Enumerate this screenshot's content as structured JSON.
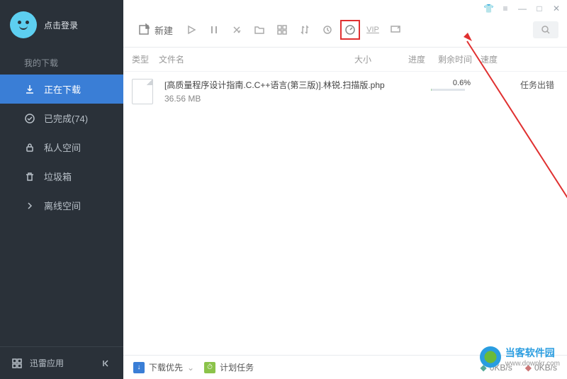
{
  "user": {
    "login_prompt": "点击登录"
  },
  "sidebar": {
    "section": "我的下载",
    "items": [
      {
        "label": "正在下载",
        "icon": "↓"
      },
      {
        "label": "已完成(74)",
        "icon": "✓"
      },
      {
        "label": "私人空间",
        "icon": "🔒"
      },
      {
        "label": "垃圾箱",
        "icon": "🗑"
      },
      {
        "label": "离线空间",
        "icon": "☁"
      }
    ],
    "bottom": {
      "app_label": "迅雷应用",
      "icon": "⊞"
    }
  },
  "toolbar": {
    "new_label": "新建",
    "icons": [
      "play",
      "pause",
      "delete",
      "folder",
      "view",
      "sort",
      "refresh",
      "gauge",
      "vip",
      "desktop"
    ]
  },
  "headers": {
    "type": "类型",
    "name": "文件名",
    "size": "大小",
    "progress": "进度",
    "remain": "剩余时间",
    "speed": "速度"
  },
  "tasks": [
    {
      "name": "[高质量程序设计指南.C.C++语言(第三版)].林锐.扫描版.php",
      "size": "36.56 MB",
      "progress": "0.6%",
      "progress_pct": 0.6,
      "status": "任务出错"
    }
  ],
  "statusbar": {
    "priority": "下载优先",
    "schedule": "计划任务",
    "down_speed": "0KB/s",
    "up_speed": "0KB/s"
  },
  "watermark": {
    "title": "当客软件园",
    "url": "www.downkr.com"
  }
}
